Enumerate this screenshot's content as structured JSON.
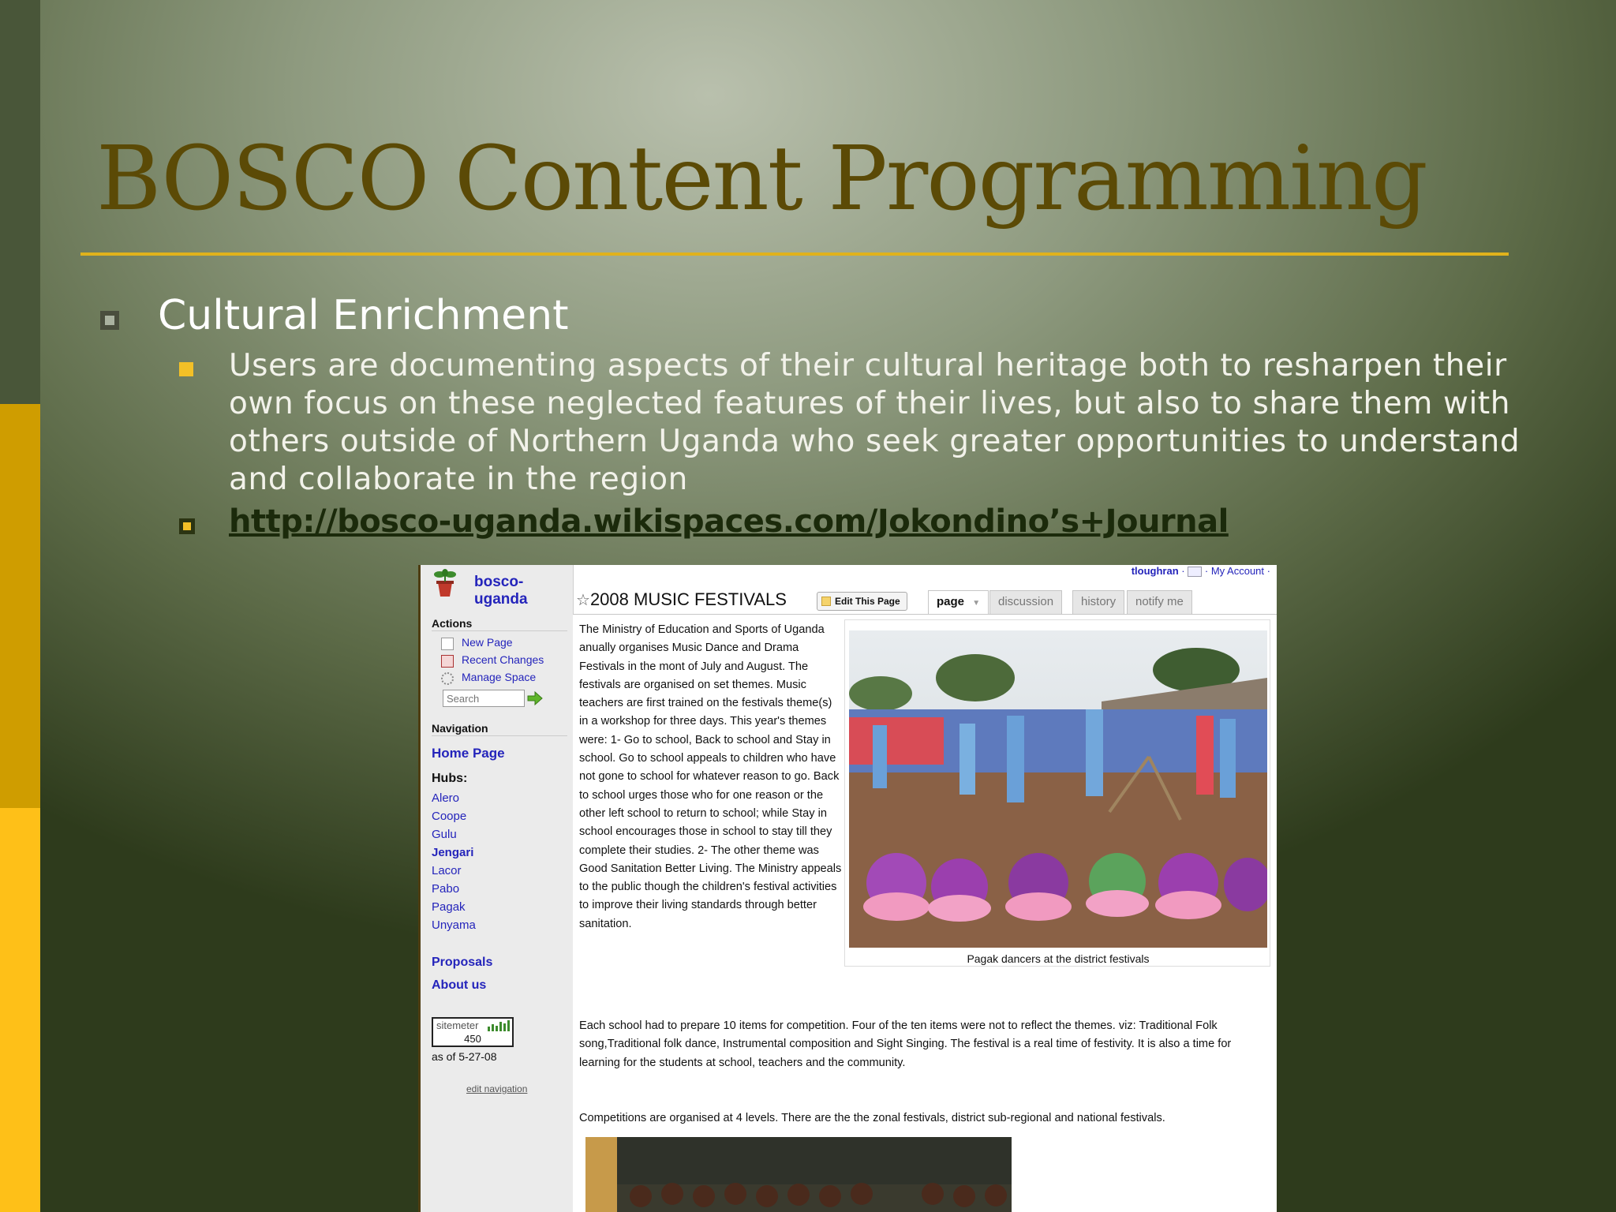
{
  "slide": {
    "title": "BOSCO Content Programming",
    "bullet1": "Cultural Enrichment",
    "bullet2": "Users are documenting aspects of their cultural heritage both to resharpen their own focus on these neglected features of their lives, but also to share them with others outside of Northern Uganda who seek greater opportunities to understand and collaborate in the region",
    "link": "http://bosco-uganda.wikispaces.com/Jokondino’s+Journal",
    "colors": {
      "title": "#5b4a06",
      "rule": "#e0b21c",
      "bar_top": "#495639",
      "bar_mid": "#cf9d00",
      "bar_bottom": "#fec018"
    }
  },
  "wiki": {
    "site_name": "bosco-uganda",
    "user": "tloughran",
    "my_account": "My Account",
    "page_title": "2008 MUSIC FESTIVALS",
    "edit_button": "Edit This Page",
    "tabs": [
      "page",
      "discussion",
      "history",
      "notify me"
    ],
    "sidebar": {
      "actions_label": "Actions",
      "actions": [
        {
          "label": "New Page",
          "icon": "new-page-icon"
        },
        {
          "label": "Recent Changes",
          "icon": "calendar-icon"
        },
        {
          "label": "Manage Space",
          "icon": "gear-icon"
        }
      ],
      "search_placeholder": "Search",
      "navigation_label": "Navigation",
      "home": "Home Page",
      "hubs_label": "Hubs:",
      "hubs": [
        "Alero",
        "Coope",
        "Gulu",
        "Jengari",
        "Lacor",
        "Pabo",
        "Pagak",
        "Unyama"
      ],
      "proposals": "Proposals",
      "about": "About us",
      "sitemeter_brand": "sitemeter",
      "sitemeter_count": "450",
      "sitemeter_date": "as of 5-27-08",
      "edit_navigation": "edit navigation"
    },
    "body": {
      "p1": "The Ministry of Education and Sports of Uganda anually organises Music Dance and Drama Festivals in the mont of July and August. The festivals are organised on set themes. Music teachers are first trained on the festivals theme(s) in a workshop for three days. This year's themes were: 1- Go to school, Back to school and Stay in school. Go to school appeals to children who have not gone to school for whatever reason to go. Back to school urges those who for one reason or the other left school to return to school; while Stay in school encourages those in school to stay till they complete their studies. 2- The other theme was Good Sanitation Better Living. The Ministry appeals to the public though the children's festival activities to improve their living standards through better sanitation.",
      "caption1": "Pagak dancers at the district festivals",
      "p2": "Each school had to prepare 10 items for competition. Four of the ten items were not to reflect the themes. viz: Traditional Folk song,Traditional folk dance, Instrumental composition and Sight Singing. The festival is a real time of festivity. It is also a time for learning for the students at school, teachers and the community.",
      "p3": "Competitions are organised at 4 levels. There are the the zonal festivals, district sub-regional and national festivals."
    }
  }
}
